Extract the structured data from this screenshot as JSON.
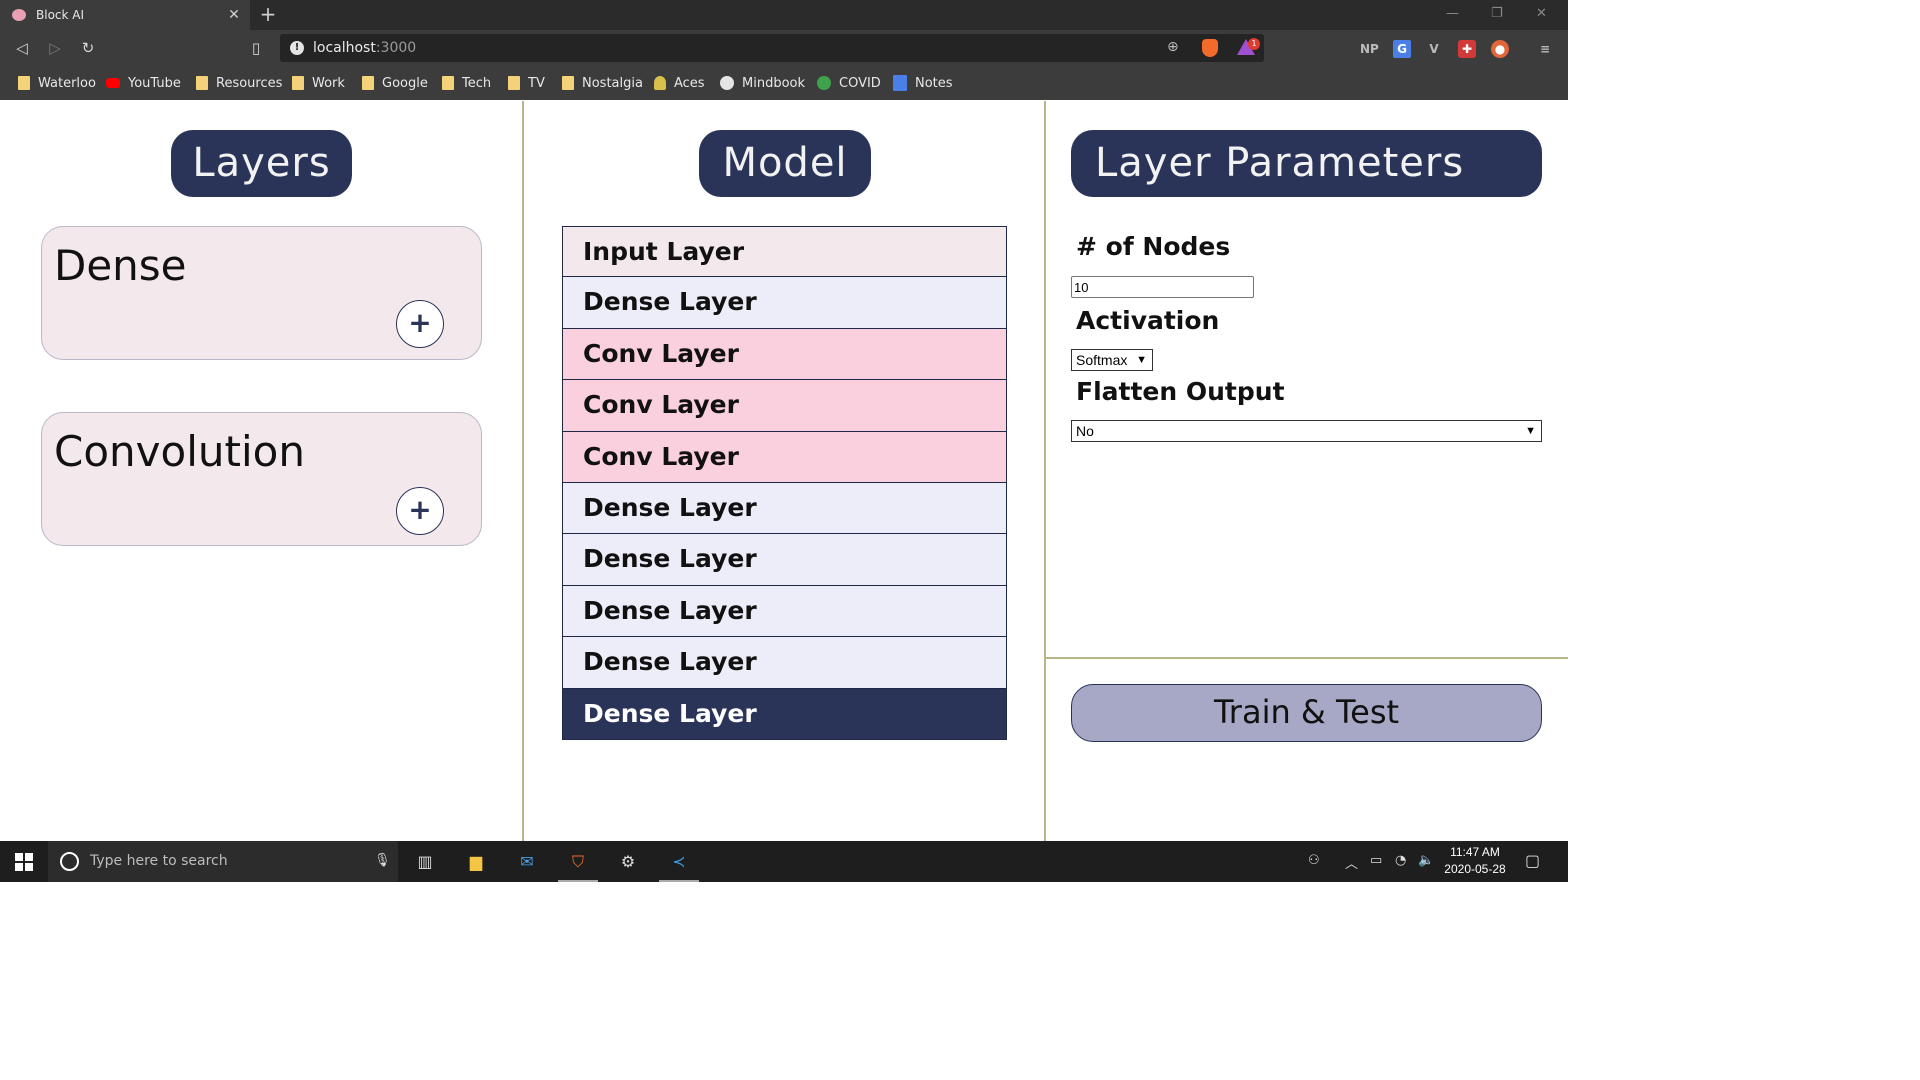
{
  "browser": {
    "tab_title": "Block AI",
    "tab_close": "✕",
    "new_tab": "+",
    "url_host": "localhost",
    "url_port": ":3000",
    "rewards_badge": "1",
    "extensions": [
      "NP"
    ],
    "bookmarks": [
      {
        "label": "Waterloo",
        "icon": "folder-icon"
      },
      {
        "label": "YouTube",
        "icon": "youtube-icon"
      },
      {
        "label": "Resources",
        "icon": "folder-icon"
      },
      {
        "label": "Work",
        "icon": "folder-icon"
      },
      {
        "label": "Google",
        "icon": "folder-icon"
      },
      {
        "label": "Tech",
        "icon": "folder-icon"
      },
      {
        "label": "TV",
        "icon": "folder-icon"
      },
      {
        "label": "Nostalgia",
        "icon": "folder-icon"
      },
      {
        "label": "Aces",
        "icon": "aces-icon"
      },
      {
        "label": "Mindbook",
        "icon": "mindbook-icon"
      },
      {
        "label": "COVID",
        "icon": "covid-icon"
      },
      {
        "label": "Notes",
        "icon": "notes-icon"
      }
    ]
  },
  "layers_panel": {
    "title": "Layers",
    "cards": [
      {
        "title": "Dense",
        "add_label": "+"
      },
      {
        "title": "Convolution",
        "add_label": "+"
      }
    ]
  },
  "model_panel": {
    "title": "Model",
    "rows": [
      {
        "label": "Input Layer",
        "kind": "input"
      },
      {
        "label": "Dense Layer",
        "kind": "dense"
      },
      {
        "label": "Conv Layer",
        "kind": "conv"
      },
      {
        "label": "Conv Layer",
        "kind": "conv"
      },
      {
        "label": "Conv Layer",
        "kind": "conv"
      },
      {
        "label": "Dense Layer",
        "kind": "dense"
      },
      {
        "label": "Dense Layer",
        "kind": "dense"
      },
      {
        "label": "Dense Layer",
        "kind": "dense"
      },
      {
        "label": "Dense Layer",
        "kind": "dense"
      },
      {
        "label": "Dense Layer",
        "kind": "selected"
      }
    ]
  },
  "params_panel": {
    "title": "Layer Parameters",
    "nodes_label": "# of Nodes",
    "nodes_value": "10",
    "activation_label": "Activation",
    "activation_value": "Softmax",
    "flatten_label": "Flatten Output",
    "flatten_value": "No",
    "caret": "▼"
  },
  "train_button": "Train & Test",
  "taskbar": {
    "search_placeholder": "Type here to search",
    "time": "11:47 AM",
    "date": "2020-05-28"
  },
  "colors": {
    "navy": "#2a3358",
    "input_row": "#f3e8ec",
    "dense_row": "#ededfa",
    "conv_row": "#fad0df",
    "train_button": "#a6a8c6",
    "divider": "#b9b48a"
  }
}
